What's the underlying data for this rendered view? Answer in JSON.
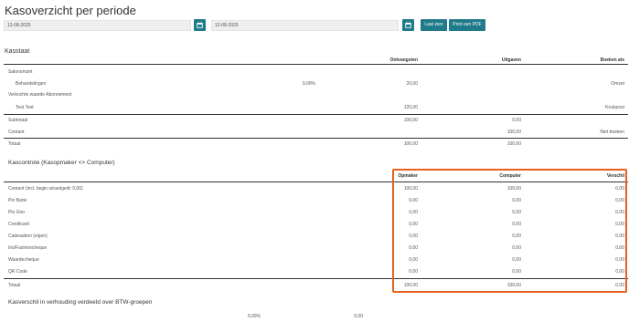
{
  "header": {
    "title": "Kasoverzicht per periode"
  },
  "filters": {
    "date_from": "12-08-2025",
    "date_to": "12-08-2025",
    "load_label": "Laat zien",
    "pdf_label": "Print een PDF"
  },
  "kasstaat": {
    "title": "Kasstaat",
    "columns": [
      "Ontvangsten",
      "Uitgaven",
      "Boeken als"
    ],
    "rows": [
      {
        "label": "Salonomzet",
        "pct": "",
        "ontvangsten": "",
        "uitgaven": "",
        "boeken": ""
      },
      {
        "label": "Behandelingen",
        "pct": "9,00%",
        "ontvangsten": "20,00",
        "uitgaven": "",
        "boeken": "Omzet"
      },
      {
        "label": "Verkochte waarde Abonnement",
        "pct": "",
        "ontvangsten": "",
        "uitgaven": "",
        "boeken": ""
      },
      {
        "label": "Test Test",
        "pct": "",
        "ontvangsten": "120,00",
        "uitgaven": "",
        "boeken": "Kruispost"
      },
      {
        "label": "Subtotaal",
        "pct": "",
        "ontvangsten": "100,00",
        "uitgaven": "0,00",
        "boeken": ""
      },
      {
        "label": "Contant",
        "pct": "",
        "ontvangsten": "",
        "uitgaven": "100,00",
        "boeken": "Niet boeken"
      },
      {
        "label": "Totaal",
        "pct": "",
        "ontvangsten": "100,00",
        "uitgaven": "100,00",
        "boeken": ""
      }
    ]
  },
  "kascontrole": {
    "title": "Kascontrole (Kasopmaker <> Computer)",
    "columns": [
      "Opmaker",
      "Computer",
      "Verschil"
    ],
    "rows": [
      {
        "label": "Contant (incl. begin wisselgeld: 0,00)",
        "opmaker": "100,00",
        "computer": "100,00",
        "verschil": "0,00"
      },
      {
        "label": "Pin Bank",
        "opmaker": "0,00",
        "computer": "0,00",
        "verschil": "0,00"
      },
      {
        "label": "Pin Giro",
        "opmaker": "0,00",
        "computer": "0,00",
        "verschil": "0,00"
      },
      {
        "label": "Creditcard",
        "opmaker": "0,00",
        "computer": "0,00",
        "verschil": "0,00"
      },
      {
        "label": "Cadeaubon (eigen)",
        "opmaker": "0,00",
        "computer": "0,00",
        "verschil": "0,00"
      },
      {
        "label": "Iris/Fashioncheque",
        "opmaker": "0,00",
        "computer": "0,00",
        "verschil": "0,00"
      },
      {
        "label": "Waardecheque",
        "opmaker": "0,00",
        "computer": "0,00",
        "verschil": "0,00"
      },
      {
        "label": "QR Code",
        "opmaker": "0,00",
        "computer": "0,00",
        "verschil": "0,00"
      },
      {
        "label": "Totaal",
        "opmaker": "100,00",
        "computer": "100,00",
        "verschil": "0,00"
      }
    ]
  },
  "btw": {
    "title": "Kasverschil in verhouding verdeeld over BTW-groepen",
    "rows": [
      {
        "pct": "9,00%",
        "value": "0,00"
      }
    ]
  },
  "colors": {
    "accent": "#1f7a8a",
    "highlight": "#e8601c"
  },
  "icons": {
    "calendar": "calendar-icon"
  }
}
